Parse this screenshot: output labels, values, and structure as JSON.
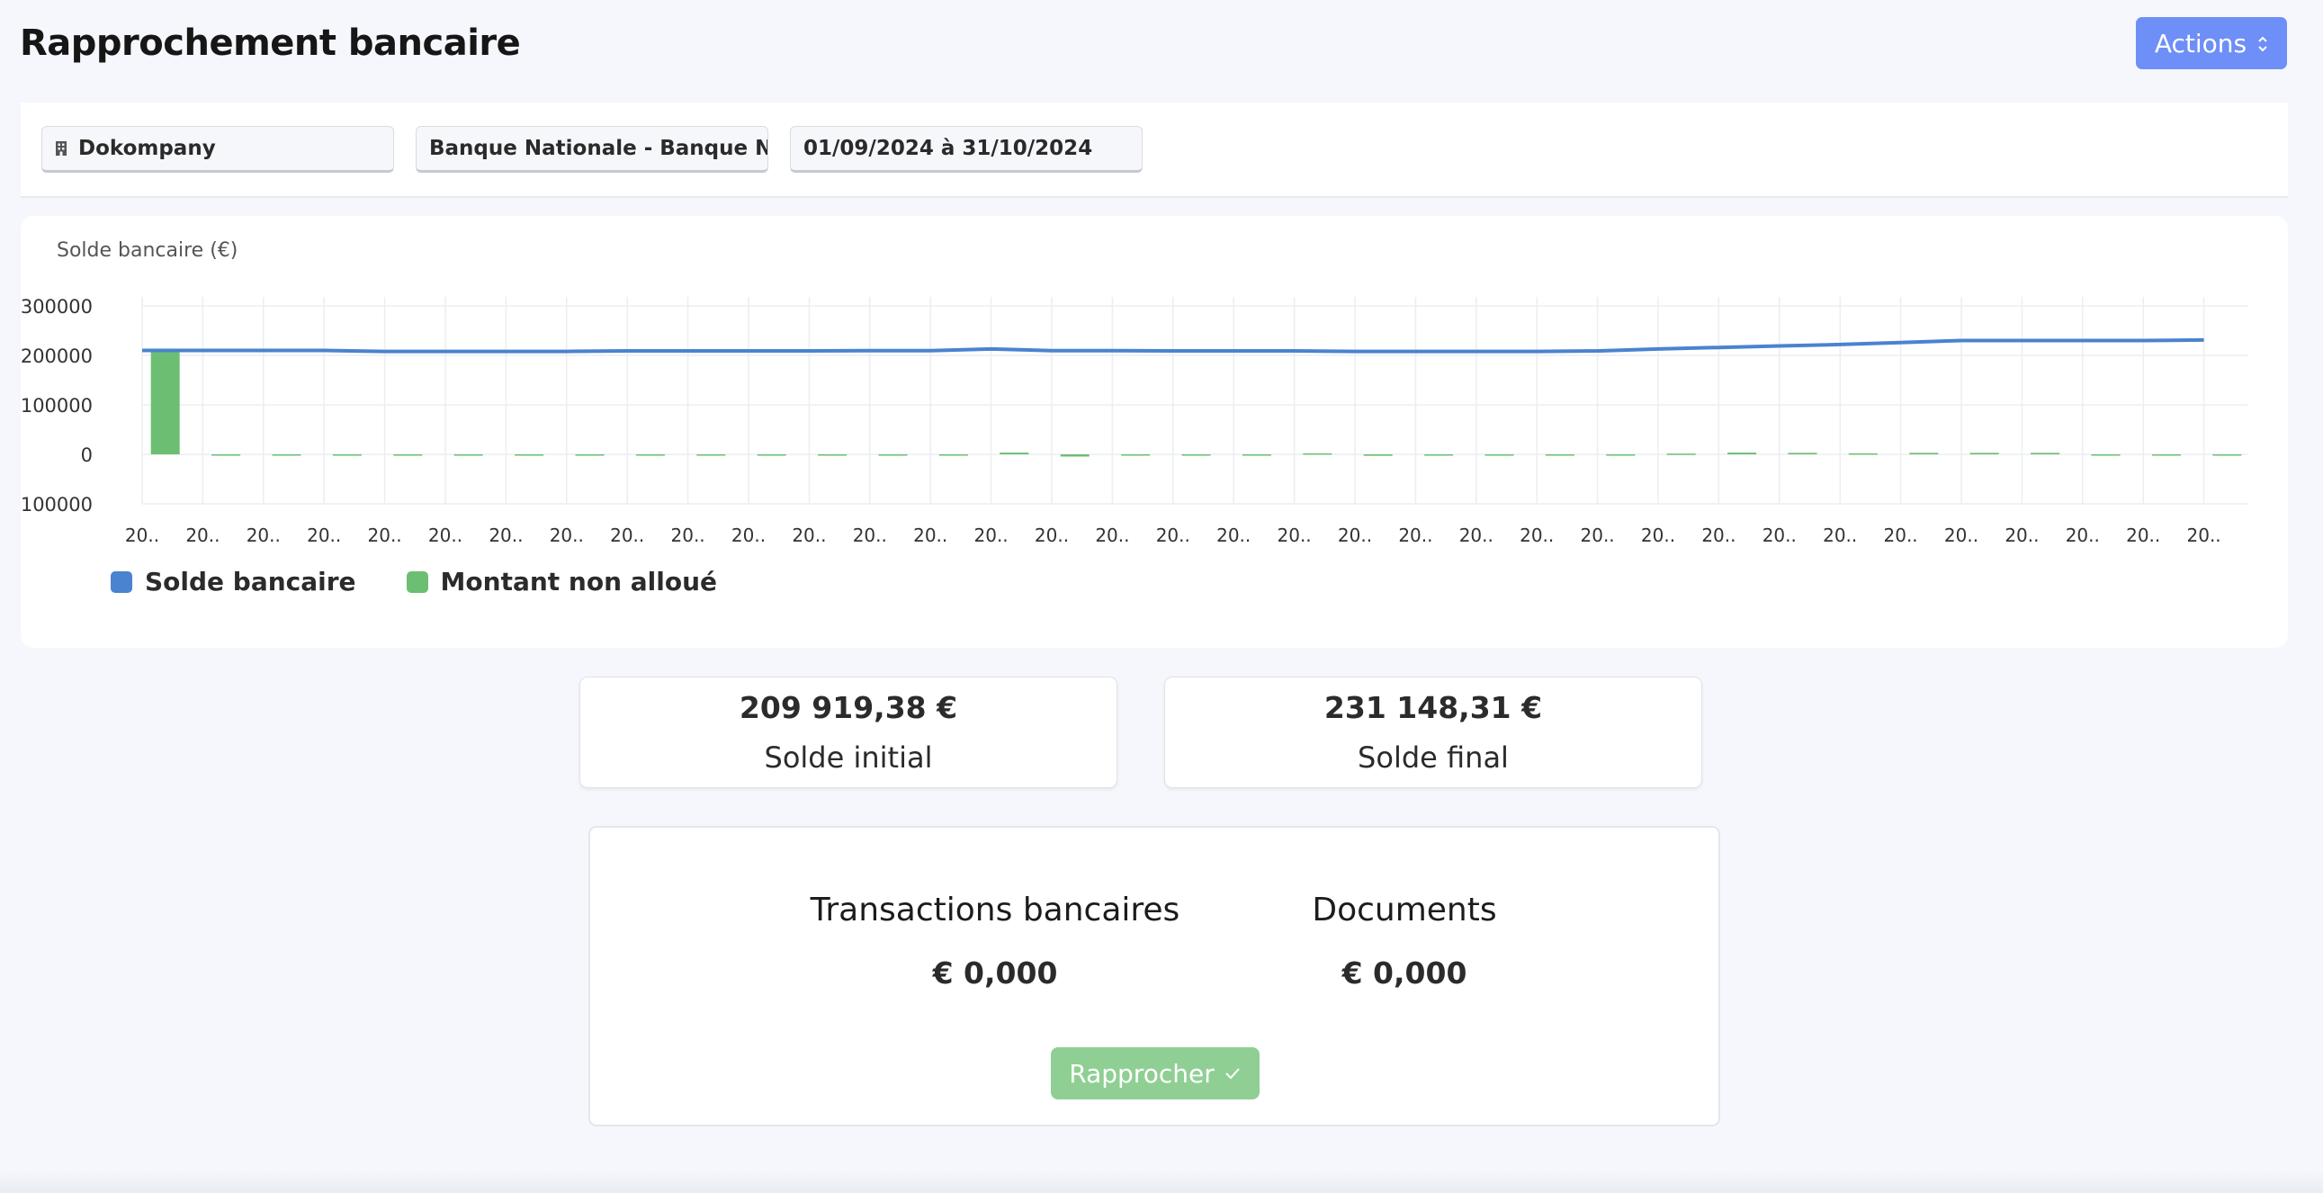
{
  "page": {
    "title": "Rapprochement bancaire",
    "actions_label": "Actions"
  },
  "filters": {
    "company": "Dokompany",
    "bank_account": "Banque Nationale - Banque Nat",
    "period": "01/09/2024 à 31/10/2024"
  },
  "chart_data": {
    "type": "line",
    "title": "Solde bancaire (€)",
    "ylim": [
      -100000,
      300000
    ],
    "yticks": [
      300000,
      200000,
      100000,
      0,
      -100000
    ],
    "x_tick_label": "20..",
    "x_tick_count": 35,
    "grid": true,
    "legend_position": "bottom-left",
    "series": [
      {
        "name": "Solde bancaire",
        "type": "line",
        "color": "#4a83cf",
        "values": [
          210000,
          210000,
          210000,
          210000,
          208000,
          208000,
          208000,
          208000,
          209000,
          209000,
          209000,
          209000,
          209500,
          209500,
          213000,
          209500,
          209500,
          209000,
          209000,
          209000,
          208000,
          208000,
          208000,
          208000,
          209000,
          213000,
          216000,
          219000,
          222000,
          226000,
          230000,
          230000,
          230000,
          230000,
          231148
        ]
      },
      {
        "name": "Montant non alloué",
        "type": "bar",
        "color": "#6cbf72",
        "values": [
          209919,
          0,
          0,
          0,
          -2500,
          0,
          0,
          0,
          -1200,
          0,
          0,
          0,
          -600,
          0,
          3500,
          -4500,
          -2000,
          -2500,
          0,
          2000,
          -3000,
          -700,
          -700,
          -700,
          -1000,
          1500,
          3500,
          3000,
          2000,
          3000,
          3000,
          3000,
          0,
          0,
          -700
        ]
      }
    ]
  },
  "balances": {
    "initial_amount": "209 919,38 €",
    "initial_label": "Solde initial",
    "final_amount": "231 148,31 €",
    "final_label": "Solde final"
  },
  "reconciliation": {
    "transactions_heading": "Transactions bancaires",
    "transactions_amount": "€ 0,000",
    "documents_heading": "Documents",
    "documents_amount": "€ 0,000",
    "button_label": "Rapprocher"
  }
}
